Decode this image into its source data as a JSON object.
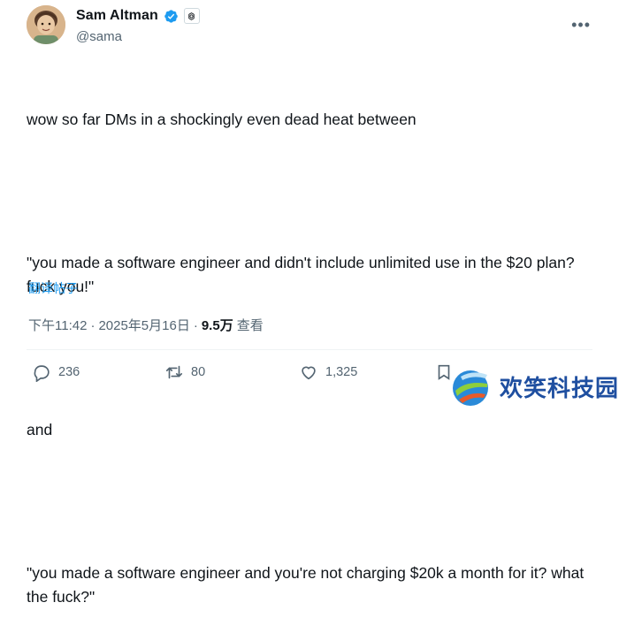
{
  "author": {
    "display_name": "Sam Altman",
    "handle": "@sama",
    "verified_icon": "verified-badge-icon",
    "affiliation_icon": "openai-logo-icon"
  },
  "tweet": {
    "lines": [
      "wow so far DMs in a shockingly even dead heat between",
      "\"you made a software engineer and didn't include unlimited use in the $20 plan? fuck you!\"",
      "and",
      "\"you made a software engineer and you're not charging $20k a month for it? what the fuck?\""
    ],
    "translate_label": "翻译帖子",
    "time": "下午11:42",
    "separator": "·",
    "date": "2025年5月16日",
    "separator2": "·",
    "views": "9.5万",
    "views_label": "查看"
  },
  "actions": {
    "replies": "236",
    "reposts": "80",
    "likes": "1,325"
  },
  "watermark": {
    "text": "欢笑科技园"
  },
  "colors": {
    "text": "#0f1419",
    "secondary": "#536471",
    "link": "#1d9bf0",
    "verified": "#1d9bf0",
    "watermark": "#1f4fa0"
  }
}
